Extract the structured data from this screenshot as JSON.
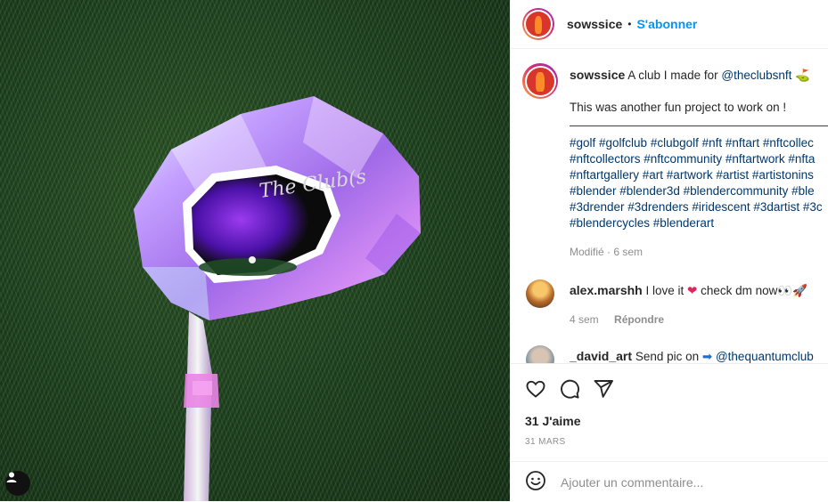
{
  "header": {
    "username": "sowssice",
    "separator": "•",
    "follow_label": "S'abonner"
  },
  "caption": {
    "username": "sowssice",
    "text_prefix": "A club I made for",
    "mention": "@theclubsnft",
    "mention_emoji": "⛳",
    "line2": "This was another fun project to work on !",
    "divider": "__________________________________________",
    "hashtag_lines": [
      "#golf #golfclub #clubgolf #nft #nftart #nftcollec",
      "#nftcollectors #nftcommunity #nftartwork #nfta",
      "#nftartgallery #art #artwork #artist #artistonins",
      "#blender #blender3d #blendercommunity #ble",
      "#3drender #3drenders #iridescent #3dartist #3c",
      "#blendercycles #blenderart"
    ],
    "meta": "Modifié · 6 sem"
  },
  "comments": [
    {
      "username": "alex.marshh",
      "text_before": "I love it",
      "heart": "❤",
      "text_after": "check dm now👀🚀",
      "age": "4 sem",
      "reply_label": "Répondre"
    },
    {
      "username": "_david_art",
      "text_before": "Send pic on",
      "arrow": "➡",
      "mention": "@thequantumclub"
    }
  ],
  "actions": {
    "icons": [
      "heart-icon",
      "comment-icon",
      "share-icon"
    ],
    "likes": "31 J'aime",
    "date": "31 MARS"
  },
  "add_comment": {
    "emoji_icon": "smiley-icon",
    "placeholder": "Ajouter un commentaire..."
  },
  "media": {
    "engraving": "The Club(s"
  },
  "colors": {
    "accent": "#0095f6",
    "link": "#00376b",
    "muted": "#8e8e8e"
  }
}
